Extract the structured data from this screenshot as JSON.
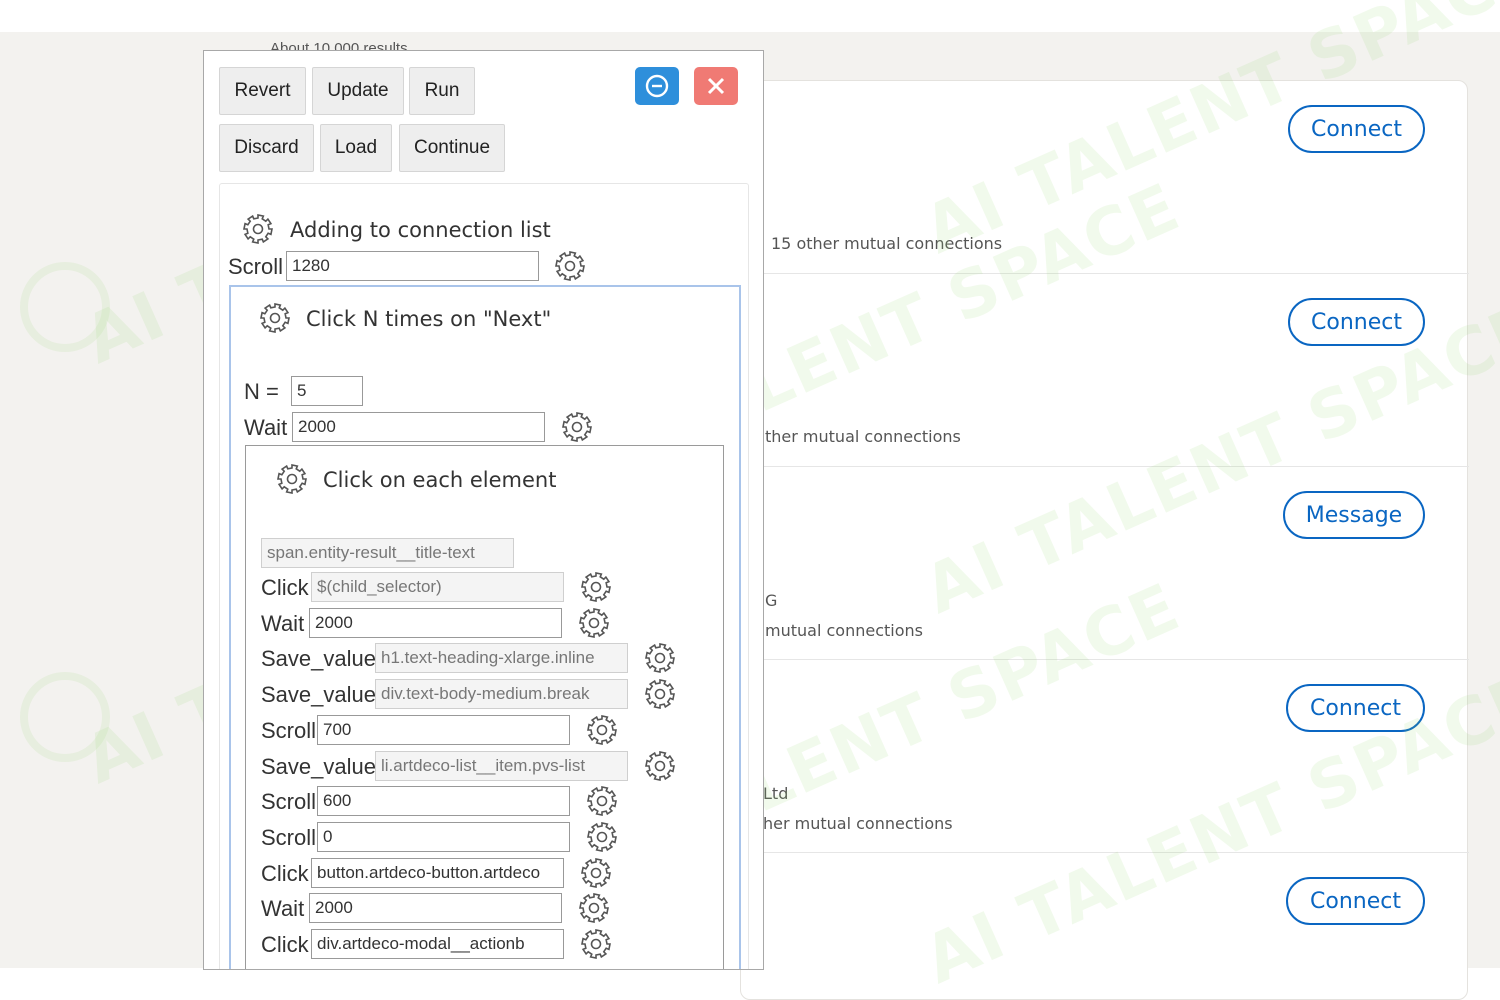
{
  "background": {
    "clipped_top_text": "About 10,000 results",
    "results": [
      {
        "text": "15 other mutual connections",
        "button": "Connect"
      },
      {
        "text": "ther mutual connections",
        "button": "Connect"
      },
      {
        "text": "G",
        "text2": "mutual connections",
        "button": "Message"
      },
      {
        "text": "Ltd",
        "text2": "her mutual connections",
        "button": "Connect"
      },
      {
        "text": "",
        "button": "Connect"
      }
    ],
    "watermark": "AI TALENT SPACE",
    "colors": {
      "accent": "#0a66c2",
      "canvas": "#f3f2ef"
    }
  },
  "toolbar": {
    "revert": "Revert",
    "update": "Update",
    "run": "Run",
    "discard": "Discard",
    "load": "Load",
    "continue": "Continue",
    "minimize_icon": "minus-circle-icon",
    "close_icon": "close-icon",
    "colors": {
      "minimize": "#2e8fdb",
      "close": "#f07a74"
    }
  },
  "steps": {
    "outer": {
      "title": "Adding to connection list",
      "scroll_label": "Scroll",
      "scroll_value": "1280"
    },
    "mid": {
      "title": "Click N times on \"Next\"",
      "n_label": "N =",
      "n_value": "5",
      "wait_label": "Wait",
      "wait_value": "2000"
    },
    "inner": {
      "title": "Click on each element",
      "selector_placeholder": "span.entity-result__title-text",
      "actions": [
        {
          "label": "Click",
          "value": "$(child_selector)",
          "placeholder": true
        },
        {
          "label": "Wait",
          "value": "2000",
          "placeholder": false
        },
        {
          "label": "Save_value",
          "value": "h1.text-heading-xlarge.inline",
          "placeholder": true
        },
        {
          "label": "Save_value",
          "value": "div.text-body-medium.break",
          "placeholder": true
        },
        {
          "label": "Scroll",
          "value": "700",
          "placeholder": false
        },
        {
          "label": "Save_value",
          "value": "li.artdeco-list__item.pvs-list",
          "placeholder": true
        },
        {
          "label": "Scroll",
          "value": "600",
          "placeholder": false
        },
        {
          "label": "Scroll",
          "value": "0",
          "placeholder": false
        },
        {
          "label": "Click",
          "value": "button.artdeco-button.artdeco",
          "placeholder": false
        },
        {
          "label": "Wait",
          "value": "2000",
          "placeholder": false
        },
        {
          "label": "Click",
          "value": "div.artdeco-modal__actionb",
          "placeholder": false
        }
      ]
    }
  }
}
